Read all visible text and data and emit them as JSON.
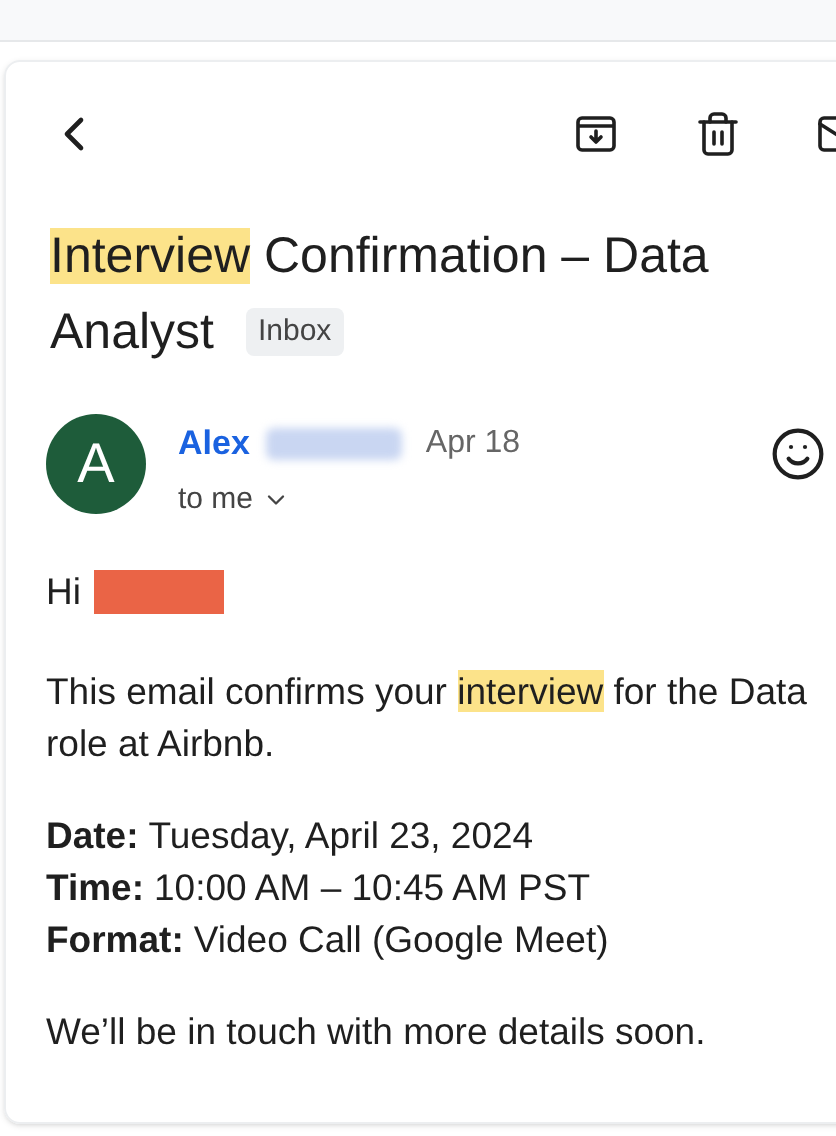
{
  "toolbar": {
    "actions": [
      {
        "kind": "archive"
      },
      {
        "kind": "delete"
      },
      {
        "kind": "mail"
      }
    ]
  },
  "subject": {
    "lines": [
      [
        {
          "text": "Interview",
          "highlight": true
        },
        {
          "text": " Confirmation – Data",
          "highlight": false
        }
      ],
      [
        {
          "text": "Analyst",
          "highlight": false
        }
      ]
    ],
    "label": "Inbox"
  },
  "message": {
    "avatar": "A",
    "sender": "Alex",
    "sender_redacted": true,
    "date": "Apr 18",
    "recipient": "to me",
    "greeting": "Hi",
    "greeting_redacted": true,
    "paragraph": [
      [
        {
          "text": "This email confirms your ",
          "highlight": false
        },
        {
          "text": "interview",
          "highlight": true
        },
        {
          "text": " for the Data",
          "highlight": false
        }
      ],
      [
        {
          "text": "role at Airbnb.",
          "highlight": false
        }
      ]
    ],
    "details": [
      {
        "label": "Date:",
        "value": "Tuesday, April 23, 2024"
      },
      {
        "label": "Time:",
        "value": "10:00 AM – 10:45 AM PST"
      },
      {
        "label": "Format:",
        "value": "Video Call (Google Meet)"
      }
    ],
    "closing": "We’ll be in touch with more details soon."
  }
}
